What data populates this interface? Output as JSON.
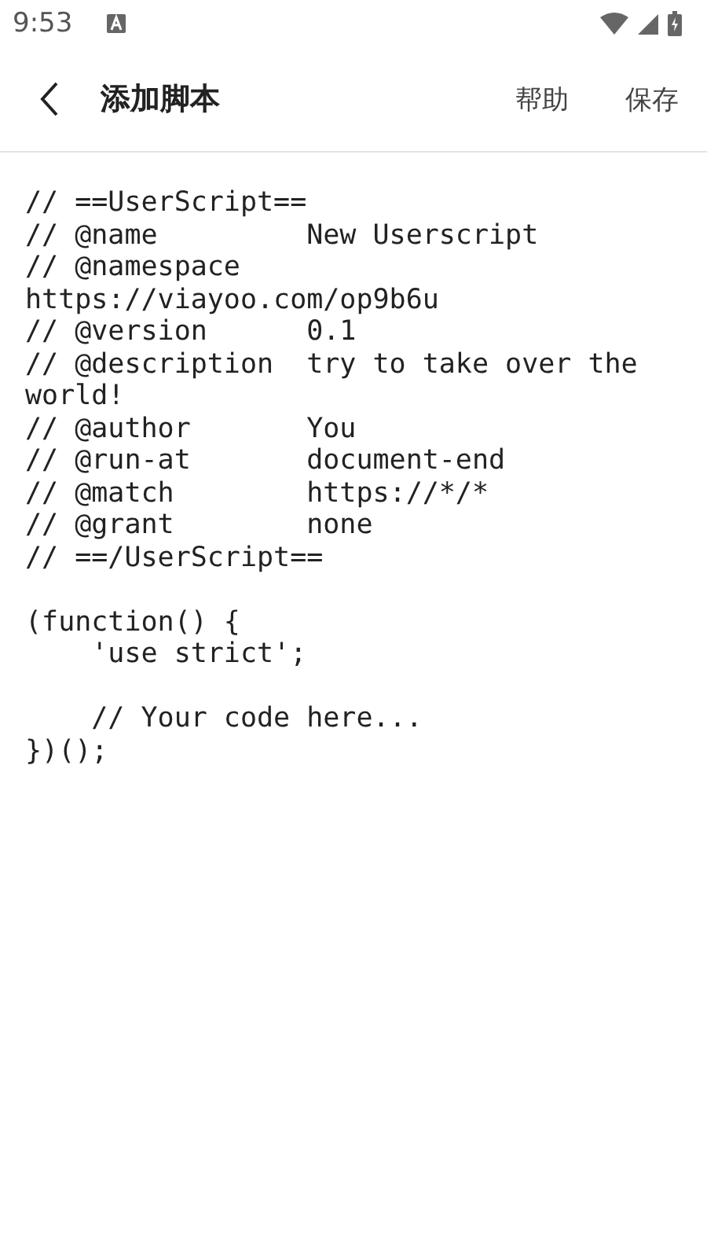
{
  "status_bar": {
    "time": "9:53"
  },
  "header": {
    "title": "添加脚本",
    "actions": [
      "帮助",
      "保存"
    ]
  },
  "editor": {
    "code": "// ==UserScript==\n// @name         New Userscript\n// @namespace\nhttps://viayoo.com/op9b6u\n// @version      0.1\n// @description  try to take over the\nworld!\n// @author       You\n// @run-at       document-end\n// @match        https://*/*\n// @grant        none\n// ==/UserScript==\n\n(function() {\n    'use strict';\n\n    // Your code here...\n})();"
  }
}
